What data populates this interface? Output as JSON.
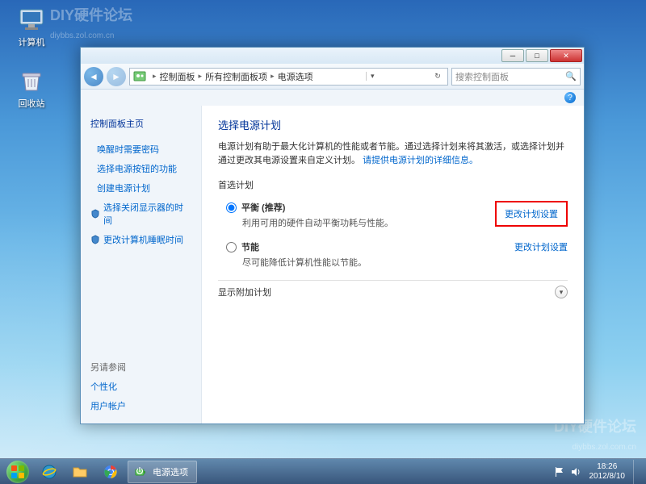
{
  "desktop": {
    "icons": [
      {
        "label": "计算机"
      },
      {
        "label": "回收站"
      }
    ],
    "watermark": {
      "title": "DIY硬件论坛",
      "sub": "diybbs.zol.com.cn"
    }
  },
  "window": {
    "breadcrumb": {
      "items": [
        "控制面板",
        "所有控制面板项",
        "电源选项"
      ]
    },
    "search": {
      "placeholder": "搜索控制面板"
    },
    "sidebar": {
      "home": "控制面板主页",
      "links": [
        "唤醒时需要密码",
        "选择电源按钮的功能",
        "创建电源计划",
        "选择关闭显示器的时间",
        "更改计算机睡眠时间"
      ],
      "see_also": "另请参阅",
      "footer_links": [
        "个性化",
        "用户帐户"
      ]
    },
    "main": {
      "title": "选择电源计划",
      "description": "电源计划有助于最大化计算机的性能或者节能。通过选择计划来将其激活，或选择计划并通过更改其电源设置来自定义计划。",
      "description_link": "请提供电源计划的详细信息。",
      "preferred_label": "首选计划",
      "plans": [
        {
          "name": "平衡 (推荐)",
          "sub": "利用可用的硬件自动平衡功耗与性能。",
          "checked": true,
          "highlighted": true
        },
        {
          "name": "节能",
          "sub": "尽可能降低计算机性能以节能。",
          "checked": false,
          "highlighted": false
        }
      ],
      "change_link": "更改计划设置",
      "show_more": "显示附加计划"
    }
  },
  "taskbar": {
    "active_task": "电源选项",
    "clock": {
      "time": "18:26",
      "date": "2012/8/10"
    }
  }
}
